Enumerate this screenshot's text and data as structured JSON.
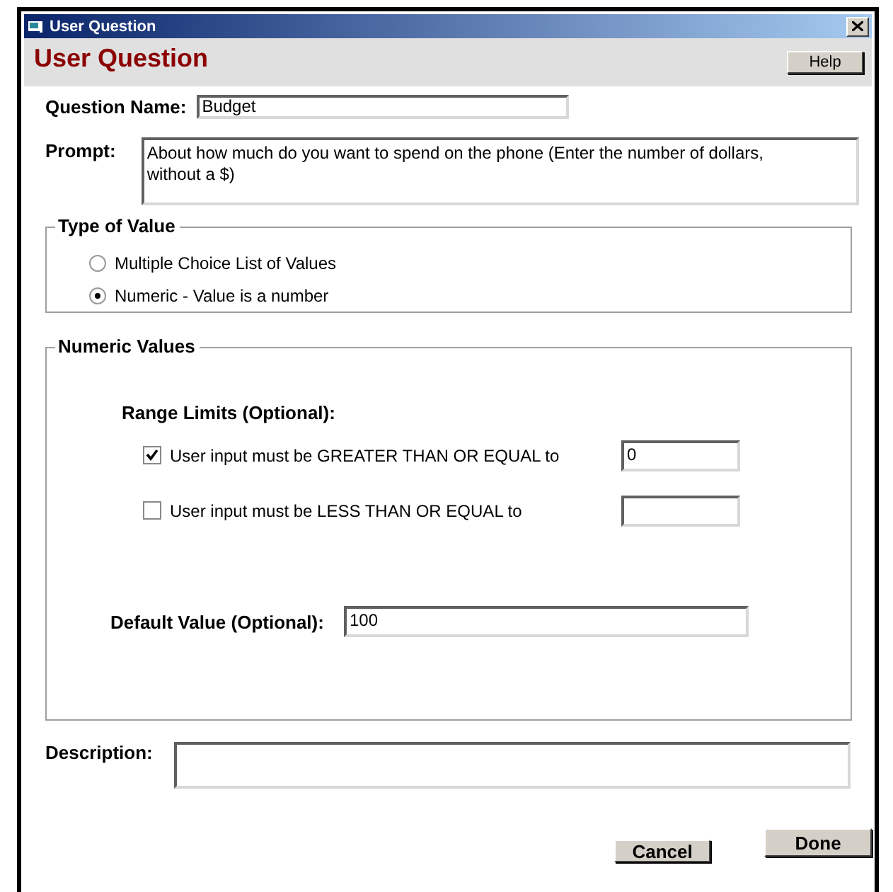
{
  "window": {
    "title": "User Question"
  },
  "header": {
    "title": "User Question",
    "help_button": "Help"
  },
  "question_name": {
    "label": "Question Name:",
    "value": "Budget"
  },
  "prompt": {
    "label": "Prompt:",
    "value": "About how much do you want to spend on the phone (Enter the number of dollars, without a $)"
  },
  "type_of_value": {
    "legend": "Type of Value",
    "options": [
      {
        "label": "Multiple Choice List of Values",
        "selected": false
      },
      {
        "label": "Numeric - Value is a number",
        "selected": true
      }
    ]
  },
  "numeric_values": {
    "legend": "Numeric Values",
    "range_title": "Range Limits (Optional):",
    "limits": [
      {
        "label": "User input must be GREATER THAN OR EQUAL to",
        "checked": true,
        "value": "0"
      },
      {
        "label": "User input must be LESS THAN OR EQUAL to",
        "checked": false
      }
    ],
    "default_label": "Default Value (Optional):",
    "default_value": "100"
  },
  "description": {
    "label": "Description:"
  },
  "buttons": [
    {
      "label": "Cancel",
      "kind": "cancel"
    },
    {
      "label": "Done",
      "kind": "done"
    }
  ]
}
